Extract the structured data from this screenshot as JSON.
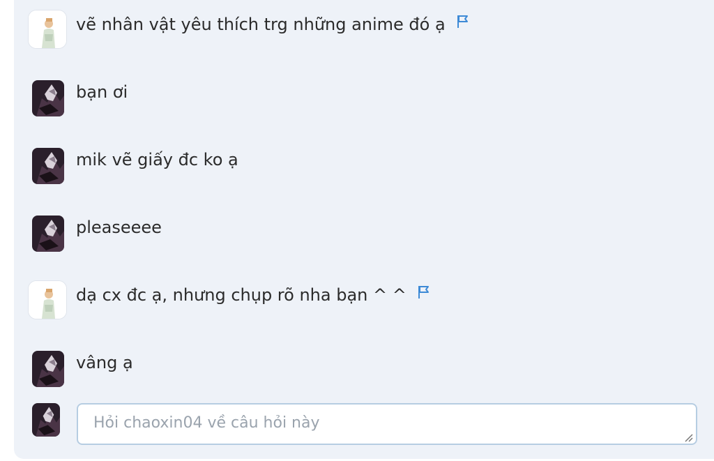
{
  "comments": [
    {
      "author": "helper",
      "text": "vẽ nhân vật yêu thích trg những anime đó ạ",
      "flag_icon": "flag-icon"
    },
    {
      "author": "user",
      "text": "bạn ơi"
    },
    {
      "author": "user",
      "text": "mik vẽ giấy đc ko ạ"
    },
    {
      "author": "user",
      "text": "pleaseeee"
    },
    {
      "author": "helper",
      "text": "dạ cx đc ạ, nhưng chụp rõ nha bạn ^ ^",
      "flag_icon": "flag-icon"
    },
    {
      "author": "user",
      "text": "vâng ạ"
    }
  ],
  "reply": {
    "placeholder": "Hỏi chaoxin04 về câu hỏi này",
    "value": ""
  },
  "colors": {
    "panel_bg": "#eef2f8",
    "flag": "#3d8ad6",
    "input_border": "#b6cde2"
  }
}
